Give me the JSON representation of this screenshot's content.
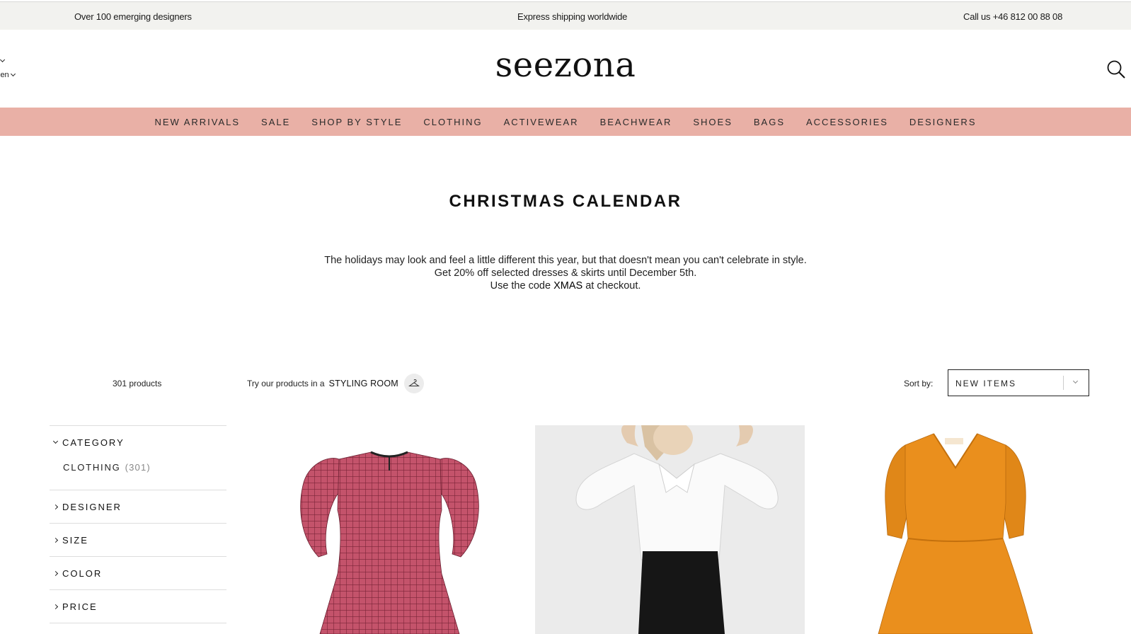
{
  "topbar": {
    "left": "Over 100 emerging designers",
    "center": "Express shipping worldwide",
    "right": "Call us +46 812 00 88 08"
  },
  "header": {
    "locale_language": "",
    "locale_country": "len",
    "logo": "seezona"
  },
  "nav": {
    "items": [
      "NEW ARRIVALS",
      "SALE",
      "SHOP BY STYLE",
      "CLOTHING",
      "ACTIVEWEAR",
      "BEACHWEAR",
      "SHOES",
      "BAGS",
      "ACCESSORIES",
      "DESIGNERS"
    ]
  },
  "page": {
    "title": "CHRISTMAS CALENDAR",
    "intro_line1": "The holidays may look and feel a little different this year, but that doesn't mean you can't celebrate in style.",
    "intro_line2": "Get 20% off selected dresses & skirts until December 5th.",
    "intro_line3_prefix": "Use the code",
    "intro_code": "XMAS",
    "intro_line3_suffix": "at checkout."
  },
  "toolbar": {
    "count": "301 products",
    "styling_prefix": "Try our products in a",
    "styling_room": "STYLING ROOM",
    "sort_label": "Sort by:",
    "sort_value": "NEW ITEMS"
  },
  "filters": {
    "category": "CATEGORY",
    "clothing": "CLOTHING",
    "clothing_count": "(301)",
    "designer": "DESIGNER",
    "size": "SIZE",
    "color": "COLOR",
    "price": "PRICE"
  },
  "products": [
    {
      "image": "pink-checked-dress",
      "color": "#c0506a"
    },
    {
      "image": "white-blouse-black-skirt",
      "color": "#ffffff"
    },
    {
      "image": "orange-dress",
      "color": "#e8891c"
    }
  ],
  "icons": [
    "search-icon",
    "hanger-icon",
    "chevron-down-icon",
    "chevron-right-icon"
  ]
}
